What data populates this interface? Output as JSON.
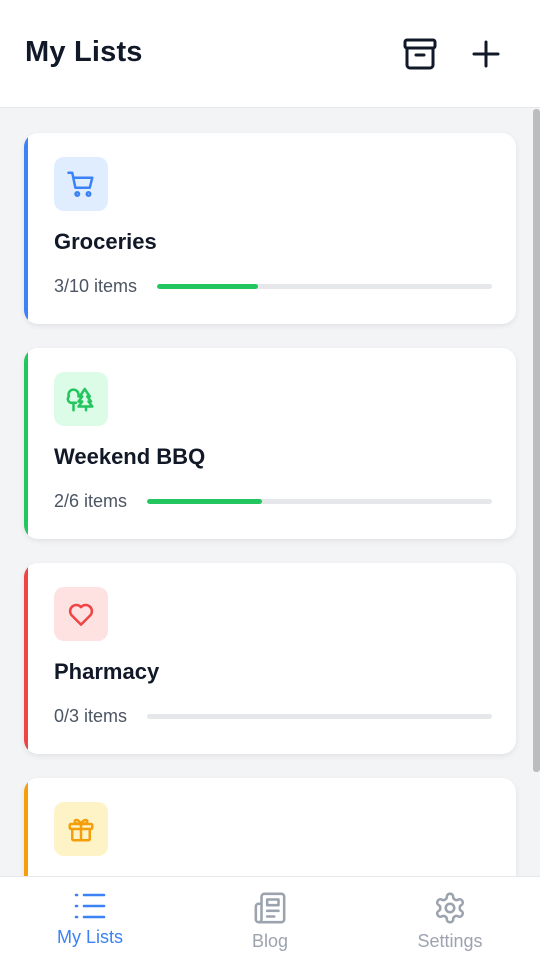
{
  "header": {
    "title": "My Lists",
    "archive_icon": "archive-icon",
    "add_icon": "plus-icon"
  },
  "lists": [
    {
      "name": "Groceries",
      "count_text": "3/10 items",
      "progress": 0.3,
      "accent": "#3b82f6",
      "icon": "shopping-cart-icon",
      "icon_bg": "#e0edff",
      "icon_color": "#3b82f6",
      "fill": "#22c55e"
    },
    {
      "name": "Weekend BBQ",
      "count_text": "2/6 items",
      "progress": 0.333,
      "accent": "#22c55e",
      "icon": "trees-icon",
      "icon_bg": "#dcfce7",
      "icon_color": "#22c55e",
      "fill": "#22c55e"
    },
    {
      "name": "Pharmacy",
      "count_text": "0/3 items",
      "progress": 0,
      "accent": "#ef4444",
      "icon": "heart-icon",
      "icon_bg": "#fee2e2",
      "icon_color": "#ef4444",
      "fill": "#22c55e"
    },
    {
      "name": "",
      "count_text": "",
      "progress": 0,
      "accent": "#f59e0b",
      "icon": "gift-icon",
      "icon_bg": "#fef3c7",
      "icon_color": "#f59e0b",
      "fill": "#22c55e"
    }
  ],
  "nav": [
    {
      "label": "My Lists",
      "icon": "list-icon",
      "active": true
    },
    {
      "label": "Blog",
      "icon": "newspaper-icon",
      "active": false
    },
    {
      "label": "Settings",
      "icon": "gear-icon",
      "active": false
    }
  ],
  "colors": {
    "active": "#3b82f6",
    "inactive": "#9ca3af"
  }
}
